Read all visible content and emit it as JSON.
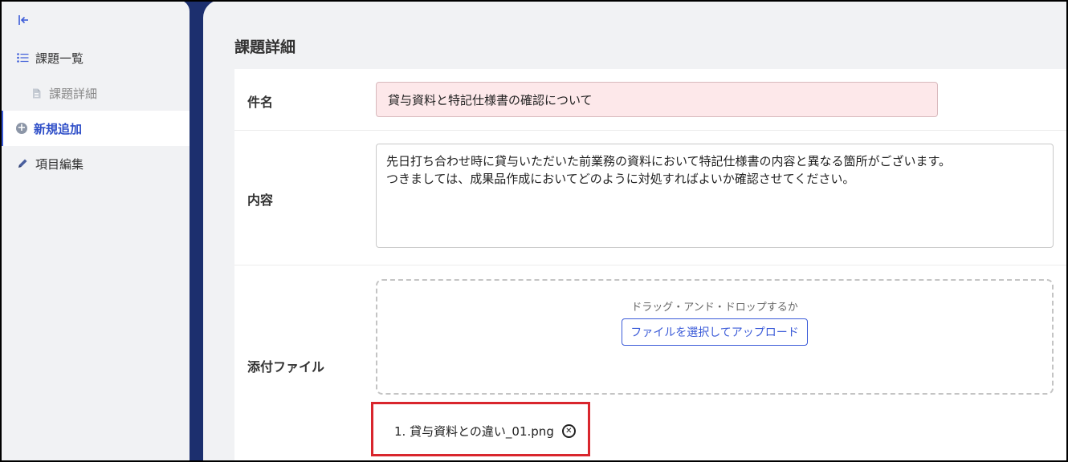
{
  "sidebar": {
    "collapse_icon": "collapse-left-icon",
    "items": [
      {
        "label": "課題一覧",
        "icon": "list-icon"
      },
      {
        "label": "課題詳細",
        "icon": "document-icon"
      },
      {
        "label": "新規追加",
        "icon": "plus-circle-icon",
        "active": true
      },
      {
        "label": "項目編集",
        "icon": "pencil-icon"
      }
    ]
  },
  "page": {
    "title": "課題詳細"
  },
  "form": {
    "subject_label": "件名",
    "subject_value": "貸与資料と特記仕様書の確認について",
    "content_label": "内容",
    "content_line1": "先日打ち合わせ時に貸与いただいた前業務の資料において特記仕様書の内容と異なる箇所がございます。",
    "content_line2": "つきましては、成果品作成においてどのように対処すればよいか確認させてください。",
    "attachment_label": "添付ファイル",
    "drop_text": "ドラッグ・アンド・ドロップするか",
    "upload_button": "ファイルを選択してアップロード",
    "files": [
      {
        "name": "1. 貸与資料との違い_01.png"
      }
    ]
  },
  "colors": {
    "accent": "#3b5bd8",
    "dark_frame": "#1c2f6e",
    "highlight": "#d9262d",
    "subject_bg": "#fde8ea"
  }
}
